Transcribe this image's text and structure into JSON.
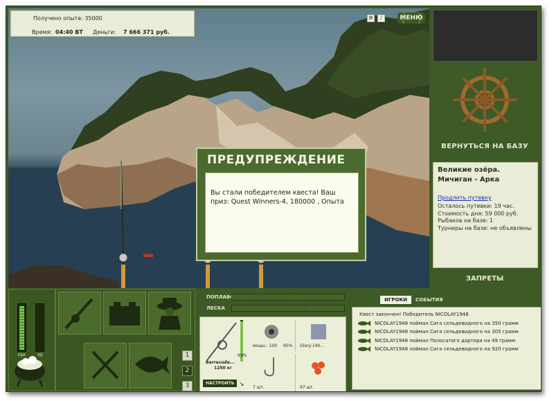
{
  "hud": {
    "exp_text": "Получено опыта: 35000",
    "time_label": "Время:",
    "time_value": "04:40 ВТ",
    "money_label": "Деньги:",
    "money_value": "7 666 371 руб.",
    "menu_label": "МЕНЮ"
  },
  "right_panel": {
    "return_label": "ВЕРНУТЬСЯ НА БАЗУ",
    "location_title": "Великие озёра. Мичиган - Арка",
    "extend_link": "Продлить путевку",
    "lines": [
      "Осталось путевки: 19 час.",
      "Стоимость дня: 59 000 руб.",
      "Рыбаков на базе: 1",
      "Турниры на базе: не объявлены"
    ],
    "bans_label": "ЗАПРЕТЫ"
  },
  "dialog": {
    "title": "ПРЕДУПРЕЖДЕНИЕ",
    "message": "Вы стали победителем квеста! Ваш приз: Quest Winners-4, 180000 , Опыта"
  },
  "status_meters": {
    "food_label": "ЕДА",
    "poison_label": "ЯД",
    "food_level": 0.95,
    "poison_level": 0.0
  },
  "slot_pages": [
    "1",
    "2",
    "3"
  ],
  "active_page": "2",
  "tackle": {
    "float_label": "ПОПЛАВОК",
    "line_label": "ЛЕСКА",
    "rod_name": "Barracuda...",
    "rod_weight": "1250 кг",
    "rod_percent": "99%",
    "setup_button": "НАСТРОИТЬ",
    "items": [
      {
        "caption": "мощн.: 100",
        "percent": "95%"
      },
      {
        "caption": "Glory-140..."
      },
      {
        "caption": "7 шт."
      },
      {
        "caption": "97 шт."
      }
    ]
  },
  "events": {
    "tab_players": "ИГРОКИ",
    "tab_events": "СОБЫТИЯ",
    "header": "Квест закончен! Победитель NICOLAY1948",
    "lines": [
      "NICOLAY1948 поймал Сига сельдевидного на 350 грамм",
      "NICOLAY1948 поймал Сига сельдевидного на 305 грамм",
      "NICOLAY1948 поймал Полосатого дартера на 49 грамм",
      "NICOLAY1948 поймал Сига сельдевидного на 920 грамм"
    ]
  },
  "colors": {
    "panel_green": "#3e5a26",
    "light_panel": "#e9ecd6",
    "link_blue": "#1a2fb3"
  }
}
